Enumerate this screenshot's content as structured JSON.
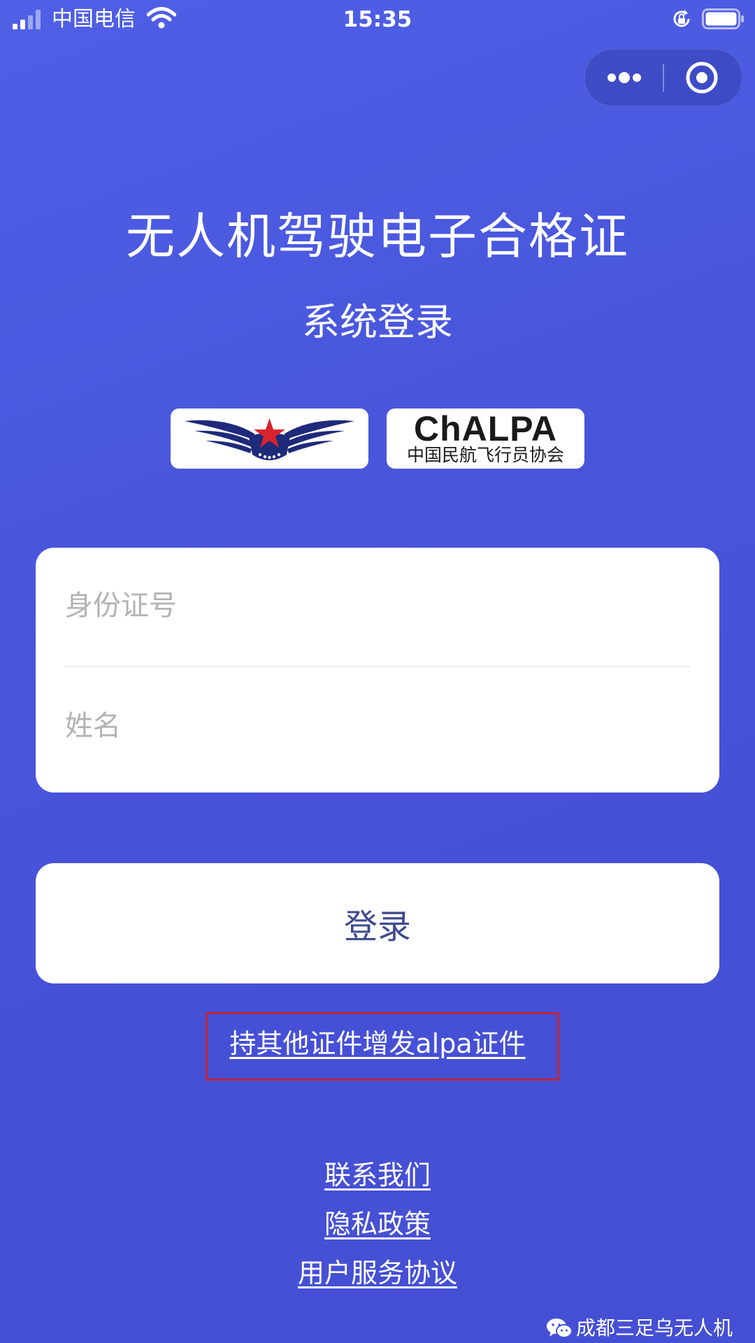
{
  "status_bar": {
    "carrier": "中国电信",
    "time": "15:35"
  },
  "capsule": {
    "more_icon": "more-dots-icon",
    "close_icon": "target-close-icon"
  },
  "header": {
    "title": "无人机驾驶电子合格证",
    "subtitle": "系统登录"
  },
  "logos": {
    "left_icon": "wings-star-emblem",
    "right_main": "ChALPA",
    "right_sub": "中国民航飞行员协会"
  },
  "form": {
    "id_placeholder": "身份证号",
    "name_placeholder": "姓名",
    "id_value": "",
    "name_value": ""
  },
  "login": {
    "label": "登录"
  },
  "links": {
    "add_certificate": "持其他证件增发alpa证件",
    "contact": "联系我们",
    "privacy": "隐私政策",
    "terms": "用户服务协议"
  },
  "watermark": {
    "text": "成都三足乌无人机"
  },
  "colors": {
    "background": "#4956dc",
    "highlight_border": "#c0243a",
    "button_text": "#3f4a8e"
  }
}
